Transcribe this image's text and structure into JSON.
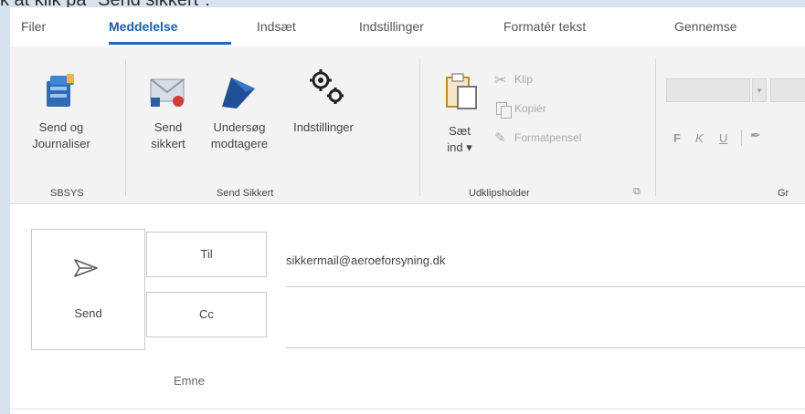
{
  "caption": "k at klik på \"Send sikkert\":",
  "tabs": [
    "Filer",
    "Meddelelse",
    "Indsæt",
    "Indstillinger",
    "Formatér tekst",
    "Gennemse"
  ],
  "ribbon": {
    "sbsys": {
      "button_line1": "Send og",
      "button_line2": "Journaliser",
      "group_label": "SBSYS"
    },
    "send_sikkert": {
      "send_line1": "Send",
      "send_line2": "sikkert",
      "undersog_line1": "Undersøg",
      "undersog_line2": "modtagere",
      "indstillinger": "Indstillinger",
      "group_label": "Send Sikkert"
    },
    "clipboard": {
      "paste_line1": "Sæt",
      "paste_line2": "ind ▾",
      "cut": "Klip",
      "copy": "Kopiér",
      "format_painter": "Formatpensel",
      "group_label": "Udklipsholder"
    },
    "basic_text": {
      "bold": "F",
      "italic": "K",
      "underline": "U",
      "group_label": "Gr"
    }
  },
  "compose": {
    "send_label": "Send",
    "to_label": "Til",
    "to_value": "sikkermail@aeroeforsyning.dk",
    "cc_label": "Cc",
    "subject_label": "Emne"
  }
}
